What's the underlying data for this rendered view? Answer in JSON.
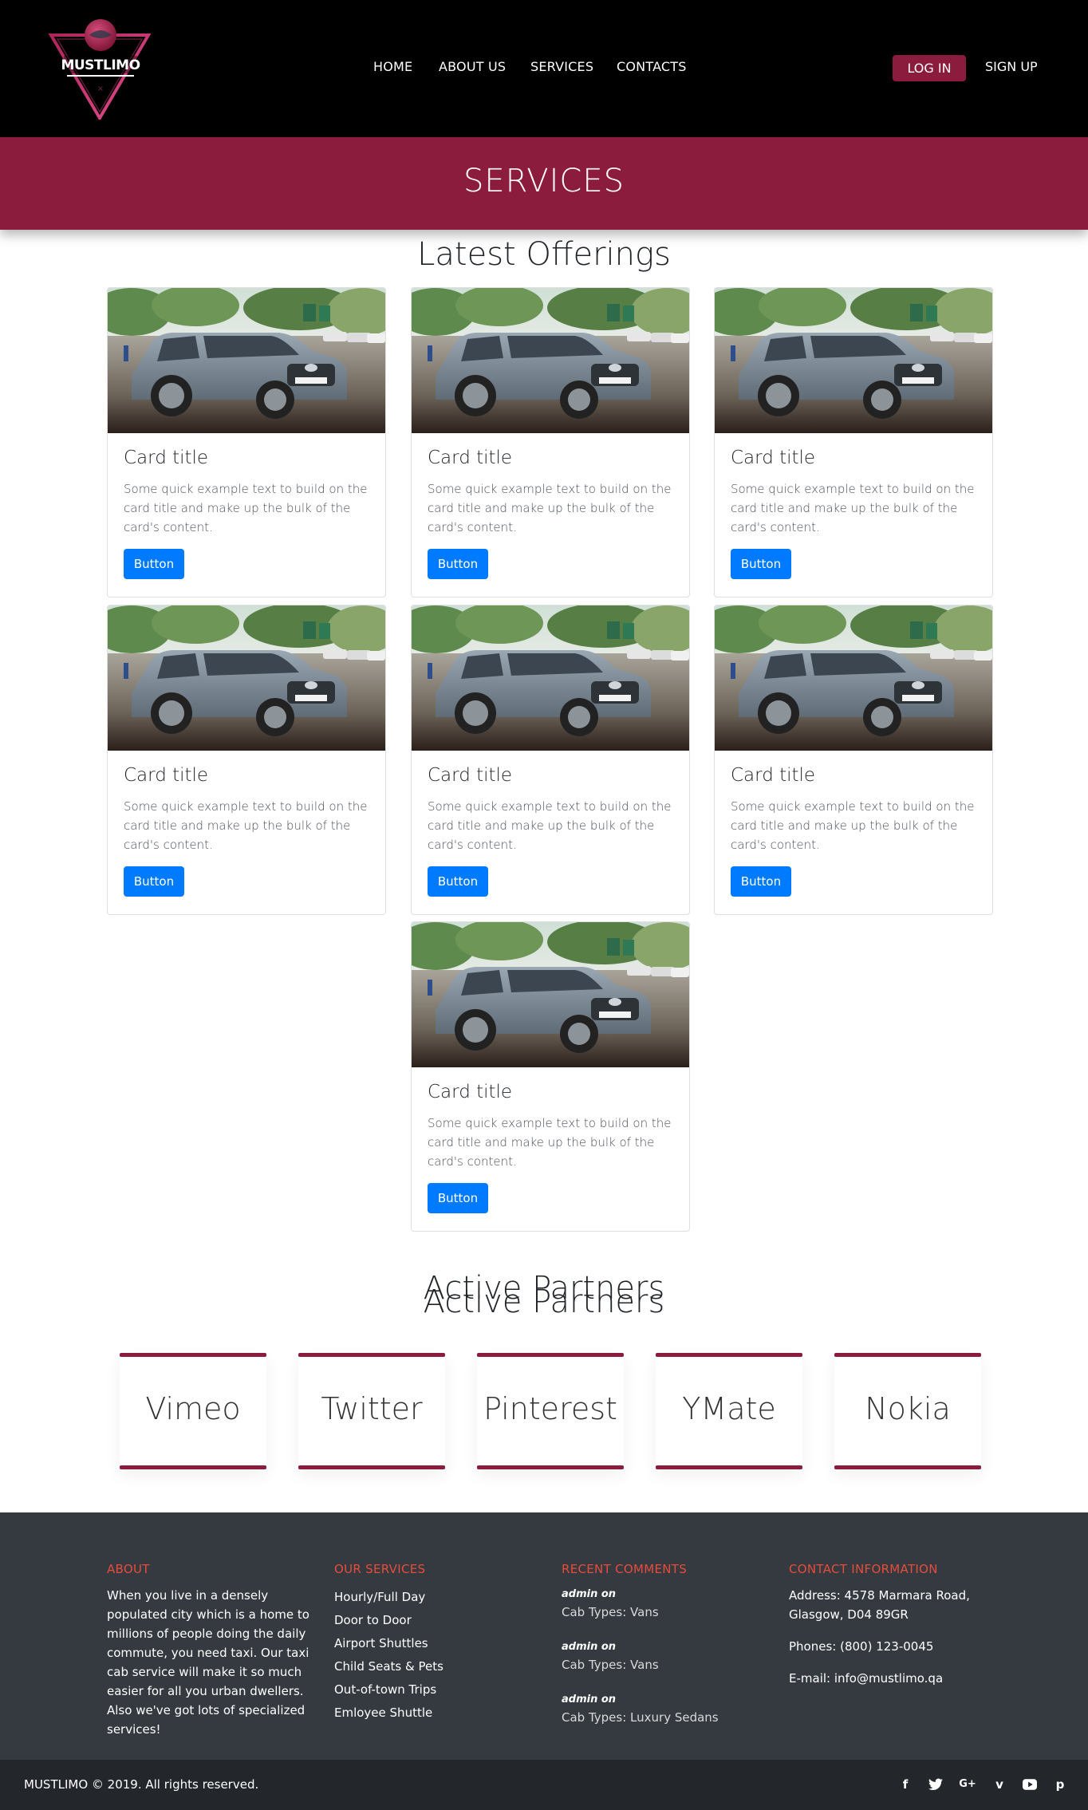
{
  "brand": {
    "name": "MUSTLIMO",
    "accent": "#8c1c3d"
  },
  "nav": {
    "items": [
      "HOME",
      "ABOUT US",
      "SERVICES",
      "CONTACTS"
    ],
    "login": "LOG IN",
    "signup": "SIGN UP"
  },
  "banner": {
    "title": "SERVICES"
  },
  "offerings": {
    "title": "Latest Offerings",
    "cards": [
      {
        "title": "Card title",
        "text": "Some quick example text to build on the card title and make up the bulk of the card's content.",
        "button": "Button"
      },
      {
        "title": "Card title",
        "text": "Some quick example text to build on the card title and make up the bulk of the card's content.",
        "button": "Button"
      },
      {
        "title": "Card title",
        "text": "Some quick example text to build on the card title and make up the bulk of the card's content.",
        "button": "Button"
      },
      {
        "title": "Card title",
        "text": "Some quick example text to build on the card title and make up the bulk of the card's content.",
        "button": "Button"
      },
      {
        "title": "Card title",
        "text": "Some quick example text to build on the card title and make up the bulk of the card's content.",
        "button": "Button"
      },
      {
        "title": "Card title",
        "text": "Some quick example text to build on the card title and make up the bulk of the card's content.",
        "button": "Button"
      },
      {
        "title": "Card title",
        "text": "Some quick example text to build on the card title and make up the bulk of the card's content.",
        "button": "Button"
      }
    ]
  },
  "partners": {
    "title": "Active Partners",
    "items": [
      "Vimeo",
      "Twitter",
      "Pinterest",
      "YMate",
      "Nokia"
    ]
  },
  "footer": {
    "about": {
      "heading": "ABOUT",
      "text": "When you live in a densely populated city which is a home to millions of people doing the daily commute, you need taxi. Our taxi cab service will make it so much easier for all you urban dwellers. Also we've got lots of specialized services!"
    },
    "services": {
      "heading": "OUR SERVICES",
      "items": [
        "Hourly/Full Day",
        "Door to Door",
        "Airport Shuttles",
        "Child Seats & Pets",
        "Out-of-town Trips",
        "Emloyee Shuttle"
      ]
    },
    "comments": {
      "heading": "RECENT COMMENTS",
      "items": [
        {
          "author": "admin on",
          "text": "Cab Types: Vans"
        },
        {
          "author": "admin on",
          "text": "Cab Types: Vans"
        },
        {
          "author": "admin on",
          "text": "Cab Types: Luxury Sedans"
        }
      ]
    },
    "contact": {
      "heading": "CONTACT INFORMATION",
      "address": "Address: 4578 Marmara Road, Glasgow, D04 89GR",
      "phone": "Phones: (800) 123-0045",
      "email": "E-mail: info@mustlimo.qa"
    },
    "copyright": "MUSTLIMO © 2019. All rights reserved.",
    "socials": [
      "facebook-icon",
      "twitter-icon",
      "google-plus-icon",
      "vimeo-icon",
      "youtube-icon",
      "pinterest-icon"
    ]
  }
}
